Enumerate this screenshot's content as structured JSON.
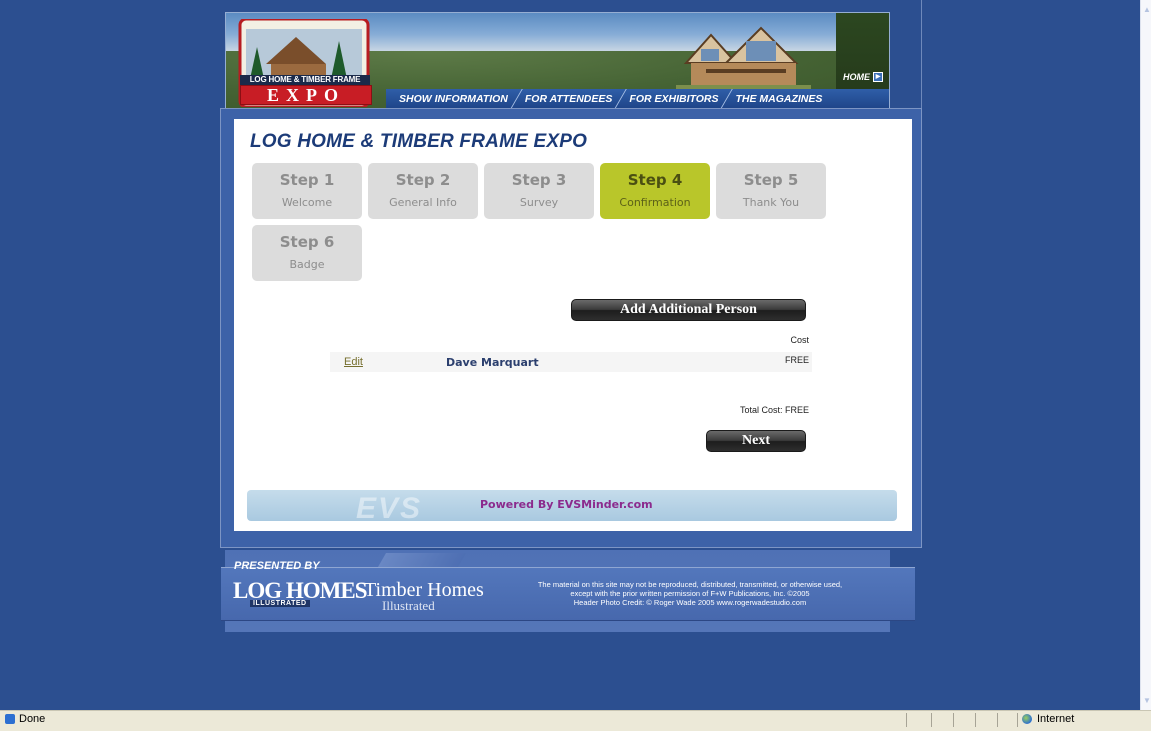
{
  "header": {
    "logo_line1": "LOG HOME & TIMBER FRAME",
    "logo_line2": "EXPO",
    "home_link": "HOME",
    "nav": [
      "SHOW INFORMATION",
      "FOR ATTENDEES",
      "FOR EXHIBITORS",
      "THE MAGAZINES"
    ]
  },
  "main": {
    "title": "LOG HOME & TIMBER FRAME EXPO",
    "steps": [
      {
        "title": "Step 1",
        "sub": "Welcome",
        "active": false
      },
      {
        "title": "Step 2",
        "sub": "General Info",
        "active": false
      },
      {
        "title": "Step 3",
        "sub": "Survey",
        "active": false
      },
      {
        "title": "Step 4",
        "sub": "Confirmation",
        "active": true
      },
      {
        "title": "Step 5",
        "sub": "Thank You",
        "active": false
      },
      {
        "title": "Step 6",
        "sub": "Badge",
        "active": false
      }
    ],
    "add_person_button": "Add Additional Person",
    "cost_header": "Cost",
    "person": {
      "edit": "Edit",
      "name": "Dave Marquart",
      "cost": "FREE"
    },
    "total_cost": "Total Cost: FREE",
    "next_button": "Next",
    "evs_watermark": "EVS",
    "powered_by": "Powered By EVSMinder.com"
  },
  "footer": {
    "presented_by": "PRESENTED BY",
    "logo_loghomes": "LOG HOMES",
    "logo_loghomes_sub": "ILLUSTRATED",
    "logo_timber": "Timber Homes",
    "logo_timber_sub": "Illustrated",
    "legal_line1": "The material on this site may not be reproduced, distributed, transmitted, or otherwise used,",
    "legal_line2": "except with the prior written permission of F+W Publications, Inc. ©2005",
    "legal_line3": "Header Photo Credit: © Roger Wade 2005  www.rogerwadestudio.com"
  },
  "statusbar": {
    "status": "Done",
    "zone": "Internet"
  },
  "colors": {
    "background": "#2c4f90",
    "active_step": "#b9c62a",
    "inactive_step": "#dcdcdc",
    "title": "#1c3b78",
    "powered_by": "#8b2a8d"
  }
}
